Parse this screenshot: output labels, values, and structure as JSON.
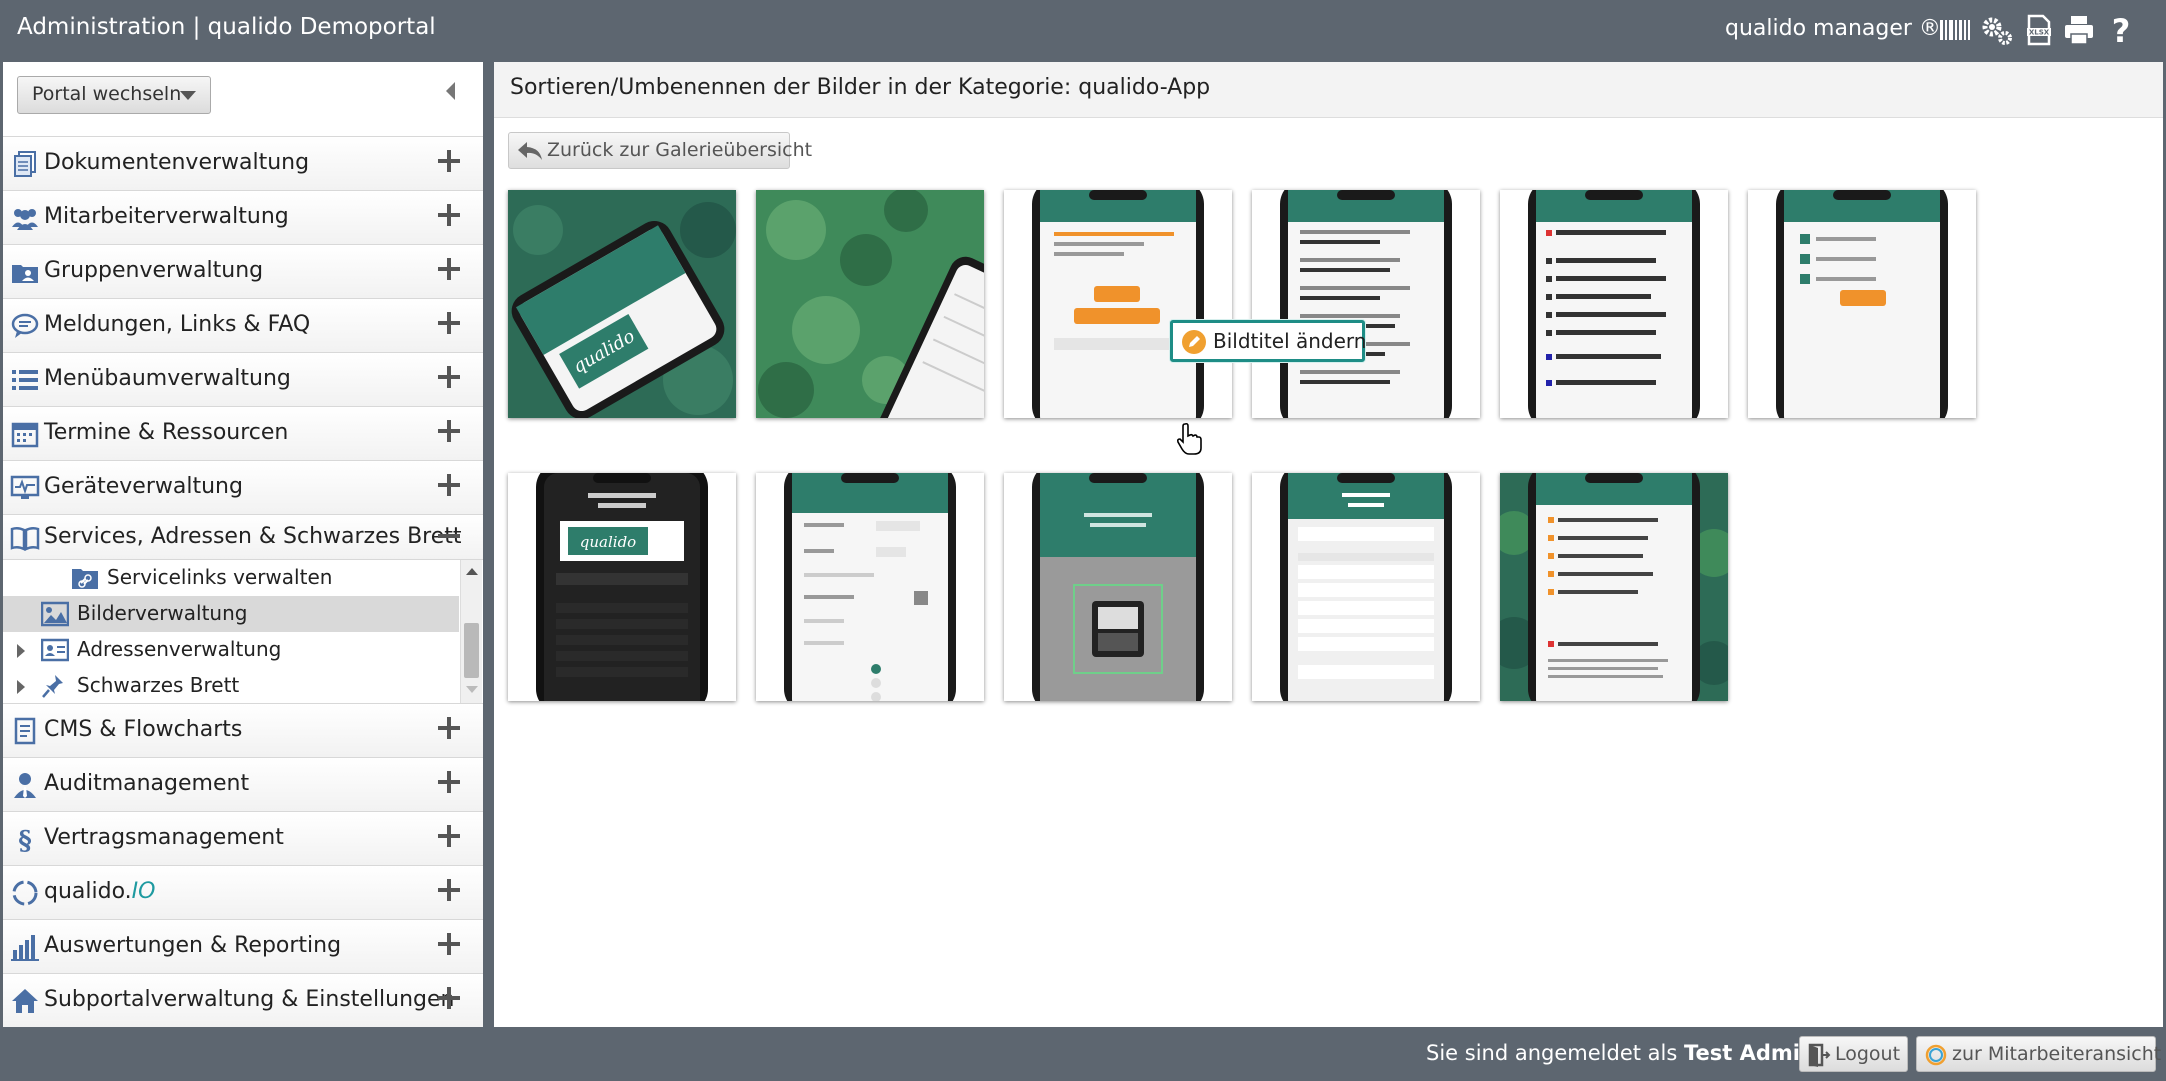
{
  "header": {
    "title": "Administration | qualido Demoportal",
    "product": "qualido manager ®",
    "icons": [
      "barcode-icon",
      "gears-icon",
      "xlsx-icon",
      "print-icon",
      "help-icon"
    ]
  },
  "sidebar": {
    "portal_switch": "Portal wechseln",
    "nav": [
      {
        "label": "Dokumentenverwaltung",
        "icon": "documents-icon"
      },
      {
        "label": "Mitarbeiterverwaltung",
        "icon": "users-icon"
      },
      {
        "label": "Gruppenverwaltung",
        "icon": "group-folder-icon"
      },
      {
        "label": "Meldungen, Links & FAQ",
        "icon": "speech-bubble-icon"
      },
      {
        "label": "Menübaumverwaltung",
        "icon": "list-icon"
      },
      {
        "label": "Termine & Ressourcen",
        "icon": "calendar-icon"
      },
      {
        "label": "Geräteverwaltung",
        "icon": "monitor-icon"
      },
      {
        "label": "Services, Adressen & Schwarzes Brett",
        "icon": "book-icon",
        "expanded": true
      },
      {
        "label": "CMS & Flowcharts",
        "icon": "cms-icon"
      },
      {
        "label": "Auditmanagement",
        "icon": "auditor-icon"
      },
      {
        "label": "Vertragsmanagement",
        "icon": "paragraph-icon"
      },
      {
        "label_main": "qualido.",
        "label_accent": "IO",
        "icon": "qualido-io-icon"
      },
      {
        "label": "Auswertungen & Reporting",
        "icon": "bar-chart-icon"
      },
      {
        "label": "Subportalverwaltung & Einstellungen",
        "icon": "home-icon"
      }
    ],
    "subtree": [
      {
        "label": "Servicelinks verwalten",
        "icon": "link-folder-icon"
      },
      {
        "label": "Bilderverwaltung",
        "icon": "image-icon",
        "selected": true
      },
      {
        "label": "Adressenverwaltung",
        "icon": "address-card-icon"
      },
      {
        "label": "Schwarzes Brett",
        "icon": "pin-icon"
      }
    ]
  },
  "main": {
    "title": "Sortieren/Umbenennen der Bilder in der Kategorie: qualido-App",
    "back_button": "Zurück zur Galerieübersicht",
    "rename_tooltip": "Bildtitel ändern",
    "thumbnails": [
      "qualido-app-phone-forest",
      "qualido-app-phone-moss",
      "termindetails-screen",
      "dokumente-screen",
      "formulare-screen",
      "push-benachrichtigungen-screen",
      "guten-morgen-dark-screen",
      "massnahme-pruefung-screen",
      "barcodesuche-screen",
      "guten-tag-screen",
      "startseite-forest-screen"
    ]
  },
  "footer": {
    "login_prefix": "Sie sind angemeldet als",
    "user": "Test Admin",
    "logout": "Logout",
    "employee_view": "zur Mitarbeiteransicht"
  },
  "colors": {
    "chrome": "#5d6670",
    "accent": "#1e8d86",
    "app_green": "#2e7d6b",
    "app_orange": "#f0922b"
  }
}
